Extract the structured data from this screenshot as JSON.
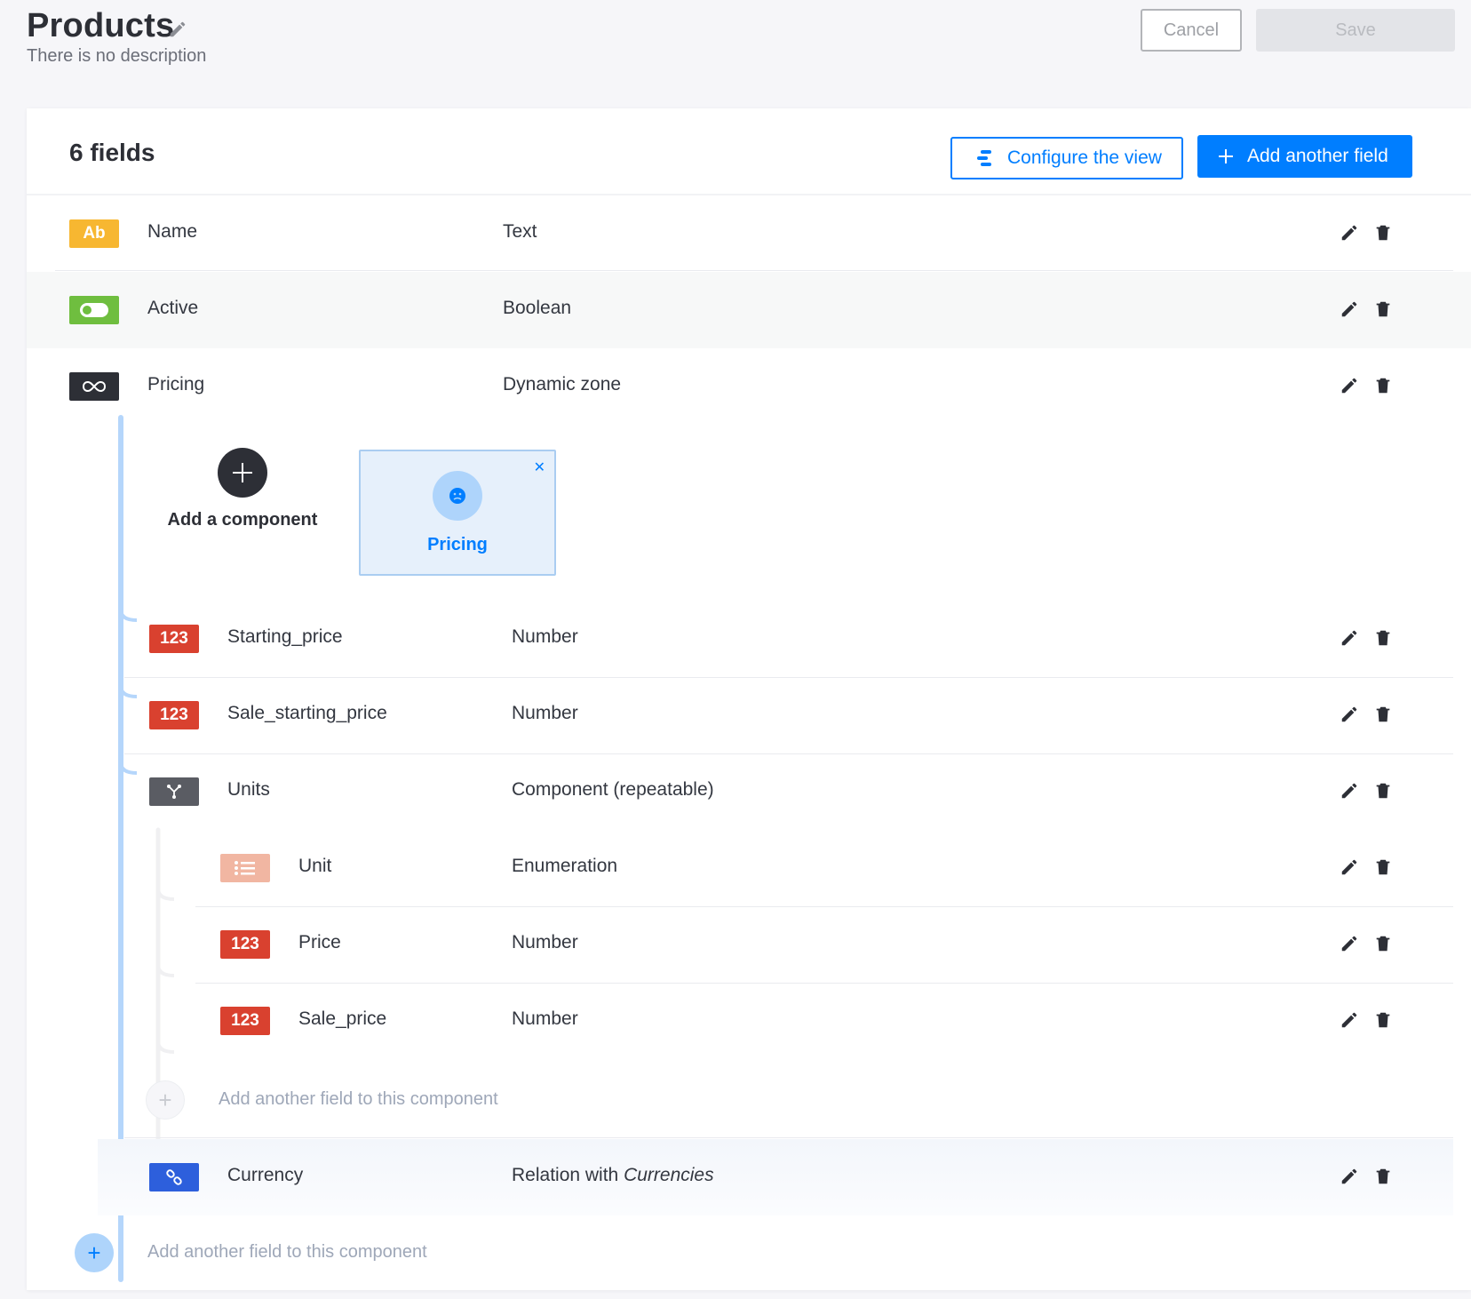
{
  "header": {
    "title": "Products",
    "description": "There is no description",
    "cancel_label": "Cancel",
    "save_label": "Save"
  },
  "content": {
    "fields_count": "6 fields",
    "configure_label": "Configure the view",
    "add_field_label": "Add another field"
  },
  "fields": [
    {
      "name": "Name",
      "type": "Text",
      "badge": "Ab",
      "badge_color": "#f7b731"
    },
    {
      "name": "Active",
      "type": "Boolean",
      "badge_icon": "toggle-icon",
      "badge_color": "#6fbe3f"
    },
    {
      "name": "Pricing",
      "type": "Dynamic zone",
      "badge_icon": "infinity-icon",
      "badge_color": "#2d2f36"
    }
  ],
  "dynamic_zone": {
    "add_component_label": "Add a component",
    "selected_component": "Pricing",
    "component_fields": [
      {
        "name": "Starting_price",
        "type": "Number",
        "badge": "123",
        "badge_color": "#d9412f"
      },
      {
        "name": "Sale_starting_price",
        "type": "Number",
        "badge": "123",
        "badge_color": "#d9412f"
      },
      {
        "name": "Units",
        "type": "Component (repeatable)",
        "badge_icon": "component-icon",
        "badge_color": "#5a5c63"
      },
      {
        "name": "Currency",
        "type_prefix": "Relation with ",
        "type_target": "Currencies",
        "badge_icon": "link-icon",
        "badge_color": "#2d5fdc"
      }
    ],
    "units_fields": [
      {
        "name": "Unit",
        "type": "Enumeration",
        "badge_icon": "list-icon",
        "badge_color": "#f1b6a2"
      },
      {
        "name": "Price",
        "type": "Number",
        "badge": "123",
        "badge_color": "#d9412f"
      },
      {
        "name": "Sale_price",
        "type": "Number",
        "badge": "123",
        "badge_color": "#d9412f"
      }
    ],
    "units_add_label": "Add another field to this component",
    "pricing_add_label": "Add another field to this component"
  }
}
